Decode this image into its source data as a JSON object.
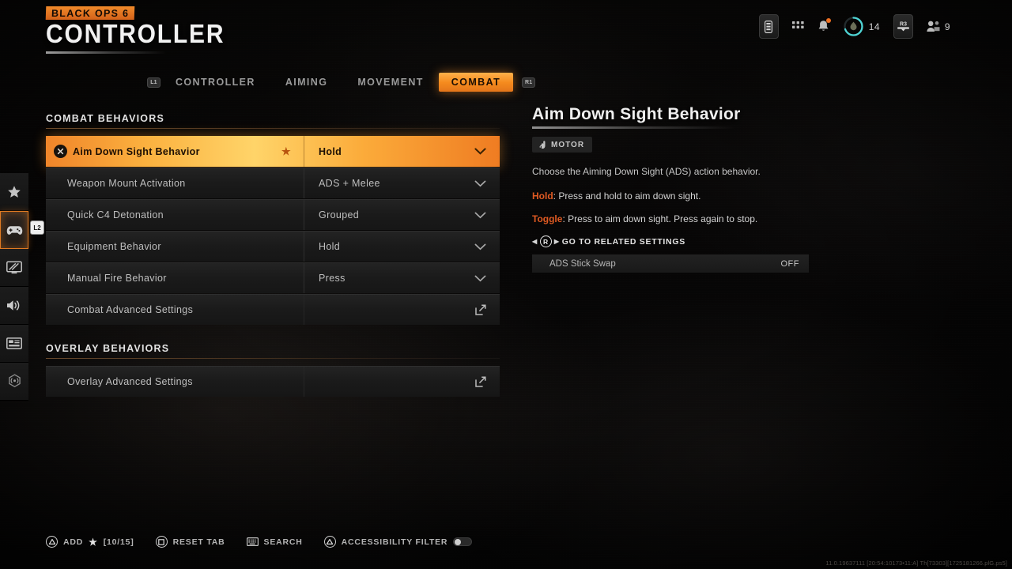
{
  "header": {
    "brand_tag": "BLACK OPS 6",
    "title": "CONTROLLER"
  },
  "hud": {
    "battery_icon": "battery-icon",
    "apps_icon": "apps-grid-icon",
    "notifications_icon": "bell-icon",
    "progress_icon": "shield-progress-icon",
    "progress_value": "14",
    "r3_label": "R3",
    "party_icon": "people-icon",
    "party_count": "9"
  },
  "nav": {
    "left_bumper": "L1",
    "right_bumper": "R1",
    "tabs": [
      {
        "label": "CONTROLLER",
        "active": false
      },
      {
        "label": "AIMING",
        "active": false
      },
      {
        "label": "MOVEMENT",
        "active": false
      },
      {
        "label": "COMBAT",
        "active": true
      }
    ]
  },
  "rail": {
    "badge": "L2",
    "items": [
      {
        "name": "favorites",
        "icon": "star-icon"
      },
      {
        "name": "controller",
        "icon": "gamepad-icon",
        "active": true
      },
      {
        "name": "graphics",
        "icon": "monitor-icon"
      },
      {
        "name": "audio",
        "icon": "speaker-icon"
      },
      {
        "name": "interface",
        "icon": "hud-card-icon"
      },
      {
        "name": "network",
        "icon": "network-icon"
      }
    ]
  },
  "sections": [
    {
      "title": "COMBAT BEHAVIORS",
      "rows": [
        {
          "label": "Aim Down Sight Behavior",
          "value": "Hold",
          "control": "dropdown",
          "selected": true,
          "starred": true
        },
        {
          "label": "Weapon Mount Activation",
          "value": "ADS + Melee",
          "control": "dropdown",
          "selected": false,
          "starred": false
        },
        {
          "label": "Quick C4 Detonation",
          "value": "Grouped",
          "control": "dropdown",
          "selected": false,
          "starred": false
        },
        {
          "label": "Equipment Behavior",
          "value": "Hold",
          "control": "dropdown",
          "selected": false,
          "starred": false
        },
        {
          "label": "Manual Fire Behavior",
          "value": "Press",
          "control": "dropdown",
          "selected": false,
          "starred": false
        },
        {
          "label": "Combat Advanced Settings",
          "value": "",
          "control": "popout",
          "selected": false,
          "starred": false
        }
      ]
    },
    {
      "title": "OVERLAY BEHAVIORS",
      "rows": [
        {
          "label": "Overlay Advanced Settings",
          "value": "",
          "control": "popout",
          "selected": false,
          "starred": false
        }
      ]
    }
  ],
  "detail": {
    "title": "Aim Down Sight Behavior",
    "badge": "MOTOR",
    "badge_icon": "hand-tap-icon",
    "description": "Choose the Aiming Down Sight (ADS) action behavior.",
    "options": [
      {
        "key": "Hold",
        "text": "Press and hold to aim down sight."
      },
      {
        "key": "Toggle",
        "text": "Press to aim down sight. Press again to stop."
      }
    ],
    "related_button": "R",
    "related_header": "GO TO RELATED SETTINGS",
    "related_rows": [
      {
        "label": "ADS Stick Swap",
        "value": "OFF"
      }
    ]
  },
  "bottom_bar": [
    {
      "button": "triangle",
      "label": "ADD",
      "star": "★",
      "count": "[10/15]"
    },
    {
      "button": "square",
      "label": "RESET TAB"
    },
    {
      "button": "keyboard",
      "label": "SEARCH"
    },
    {
      "button": "triangle",
      "label": "ACCESSIBILITY FILTER",
      "toggle": "off"
    }
  ],
  "build_string": "11.0.19637111 [20:54:10173•11:A] Th[73303][1725181266.plG.ps5]",
  "colors": {
    "accent": "#f0852a",
    "accent_bright": "#ffd469",
    "teal": "#4fd6d6",
    "bg": "#070707"
  }
}
